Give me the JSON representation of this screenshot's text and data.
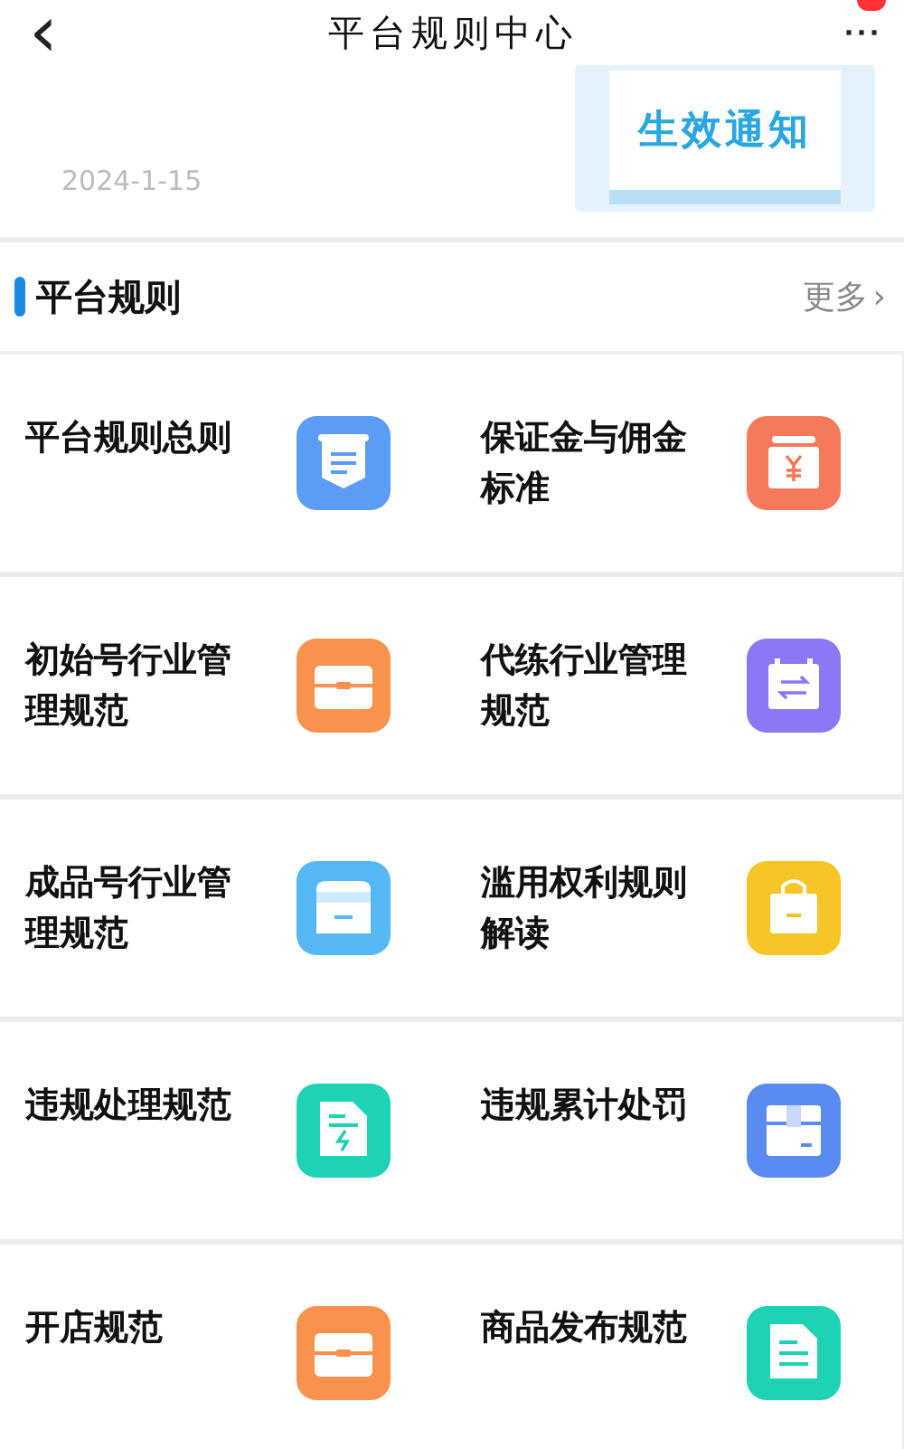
{
  "nav": {
    "back": "‹",
    "title": "平台规则中心",
    "more": "···",
    "badge": true
  },
  "notice": {
    "date": "2024-1-15",
    "thumbnail_text": "生效通知"
  },
  "section": {
    "title": "平台规则",
    "more": "更多",
    "more_arrow": "›"
  },
  "rules": [
    {
      "label": "平台规则总则",
      "kind": "shield",
      "color": "#5b9cf7"
    },
    {
      "label": "保证金与佣金标准",
      "kind": "yen",
      "color": "#f57a5b"
    },
    {
      "label": "初始号行业管理规范",
      "kind": "case",
      "color": "#f8924c"
    },
    {
      "label": "代练行业管理规范",
      "kind": "swap",
      "color": "#8c78f2"
    },
    {
      "label": "成品号行业管理规范",
      "kind": "store",
      "color": "#55b8f5"
    },
    {
      "label": "滥用权利规则解读",
      "kind": "bag",
      "color": "#f7c526"
    },
    {
      "label": "违规处理规范",
      "kind": "bolt",
      "color": "#1ed3b4"
    },
    {
      "label": "违规累计处罚",
      "kind": "box",
      "color": "#5a8cf0"
    },
    {
      "label": "开店规范",
      "kind": "case",
      "color": "#f8924c"
    },
    {
      "label": "商品发布规范",
      "kind": "doc",
      "color": "#1ed3b4"
    }
  ]
}
